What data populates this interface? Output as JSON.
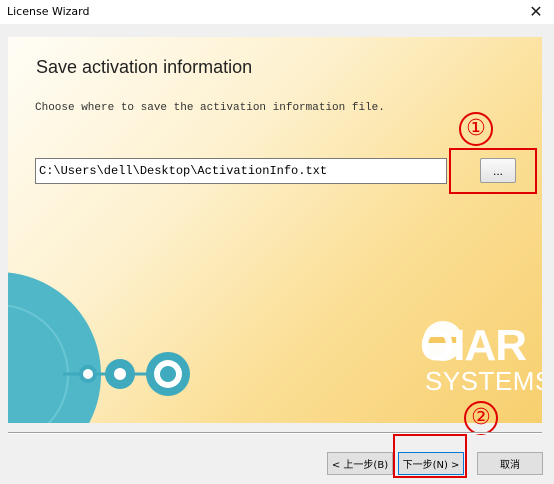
{
  "window": {
    "title": "License Wizard",
    "close_glyph": "✕"
  },
  "page": {
    "heading": "Save activation information",
    "description": "Choose where to save the activation information file.",
    "path_value": "C:\\Users\\dell\\Desktop\\ActivationInfo.txt",
    "browse_label": "..."
  },
  "annotations": {
    "one": "①",
    "two": "②",
    "color": "#e00000"
  },
  "logo": {
    "line1": "OIAR",
    "line2": "SYSTEMS",
    "color": "#ffffff"
  },
  "buttons": {
    "back": "< 上一步(B)",
    "next": "下一步(N) >",
    "cancel": "取消"
  },
  "colors": {
    "panel_light": "#fffdf6",
    "panel_gold": "#f7cf6e",
    "disc_blue": "#4fb7c8",
    "accent_border": "#0078d7"
  }
}
